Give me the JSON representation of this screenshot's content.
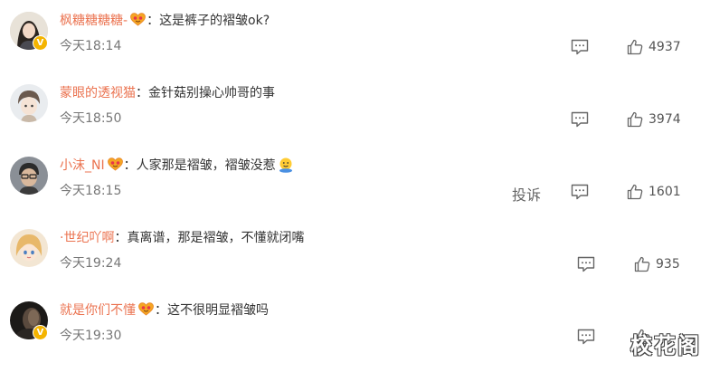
{
  "colors": {
    "username": "#eb7350",
    "text": "#333333",
    "meta": "#777777",
    "badge": "#f4b400"
  },
  "comments": [
    {
      "username": "枫糖糖糖糖-",
      "separator": "：",
      "text": "这是裤子的褶皱ok?",
      "time": "今天18:14",
      "likes": "4937",
      "report": "",
      "fan_badge": true,
      "verified": true,
      "avatar_style": "woman-dark-hair"
    },
    {
      "username": "蒙眼的透视猫",
      "separator": "：",
      "text": "金针菇别操心帅哥的事",
      "time": "今天18:50",
      "likes": "3974",
      "report": "",
      "fan_badge": false,
      "verified": false,
      "avatar_style": "anime-boy"
    },
    {
      "username": "小沫_NI",
      "separator": "：",
      "text": "人家那是褶皱，褶皱没惹",
      "time": "今天18:15",
      "likes": "1601",
      "report": "投诉",
      "fan_badge": true,
      "verified": false,
      "avatar_style": "man-glasses",
      "trailing_emoji": "hug-emoji"
    },
    {
      "username": "·世纪吖啊",
      "separator": "：",
      "text": "真离谱，那是褶皱，不懂就闭嘴",
      "time": "今天19:24",
      "likes": "935",
      "report": "",
      "fan_badge": false,
      "verified": false,
      "avatar_style": "anime-girl"
    },
    {
      "username": "就是你们不懂",
      "separator": "：",
      "text": "这不很明显褶皱吗",
      "time": "今天19:30",
      "likes": "",
      "report": "",
      "fan_badge": true,
      "verified": true,
      "avatar_style": "dark-portrait"
    }
  ],
  "watermark": "校花阁"
}
